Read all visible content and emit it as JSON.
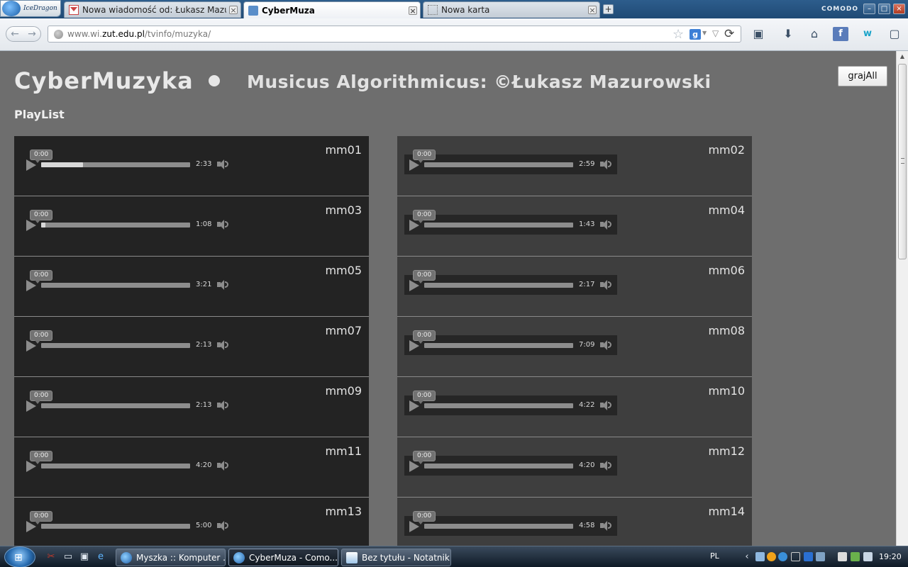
{
  "browser": {
    "logo_text": "IceDragon",
    "brand": "COMODO",
    "tabs": [
      {
        "label": "Nowa wiadomość od: Łukasz Mazurow...",
        "active": false
      },
      {
        "label": "CyberMuza",
        "active": true
      },
      {
        "label": "Nowa karta",
        "active": false
      }
    ],
    "url": {
      "prefix": "www.wi.",
      "domain": "zut.edu.pl",
      "path": "/tvinfo/muzyka/"
    }
  },
  "page": {
    "title": "CyberMuzyka",
    "subtitle": "Musicus Algorithmicus: ©Łukasz Mazurowski",
    "play_all_label": "grajAll",
    "playlist_heading": "PlayList",
    "left_tracks": [
      {
        "name": "mm01",
        "current": "0:00",
        "duration": "2:33",
        "progress": 0.28
      },
      {
        "name": "mm03",
        "current": "0:00",
        "duration": "1:08",
        "progress": 0.03
      },
      {
        "name": "mm05",
        "current": "0:00",
        "duration": "3:21",
        "progress": 0
      },
      {
        "name": "mm07",
        "current": "0:00",
        "duration": "2:13",
        "progress": 0
      },
      {
        "name": "mm09",
        "current": "0:00",
        "duration": "2:13",
        "progress": 0
      },
      {
        "name": "mm11",
        "current": "0:00",
        "duration": "4:20",
        "progress": 0
      },
      {
        "name": "mm13",
        "current": "0:00",
        "duration": "5:00",
        "progress": 0
      }
    ],
    "right_tracks": [
      {
        "name": "mm02",
        "current": "0:00",
        "duration": "2:59",
        "progress": 0
      },
      {
        "name": "mm04",
        "current": "0:00",
        "duration": "1:43",
        "progress": 0
      },
      {
        "name": "mm06",
        "current": "0:00",
        "duration": "2:17",
        "progress": 0
      },
      {
        "name": "mm08",
        "current": "0:00",
        "duration": "7:09",
        "progress": 0
      },
      {
        "name": "mm10",
        "current": "0:00",
        "duration": "4:22",
        "progress": 0
      },
      {
        "name": "mm12",
        "current": "0:00",
        "duration": "4:20",
        "progress": 0
      },
      {
        "name": "mm14",
        "current": "0:00",
        "duration": "4:58",
        "progress": 0
      }
    ]
  },
  "taskbar": {
    "buttons": [
      {
        "label": "Myszka :: Komputer ...",
        "icon": "icedragon-icon",
        "active": false
      },
      {
        "label": "CyberMuza - Como...",
        "icon": "icedragon-icon",
        "active": true
      },
      {
        "label": "Bez tytułu - Notatnik",
        "icon": "notepad-icon",
        "active": false
      }
    ],
    "language": "PL",
    "clock": "19:20"
  },
  "colors": {
    "page_bg": "#6e6e6e",
    "left_row_bg": "#232323",
    "right_row_bg": "#3e3e3e",
    "text_light": "#e9e9e9"
  }
}
